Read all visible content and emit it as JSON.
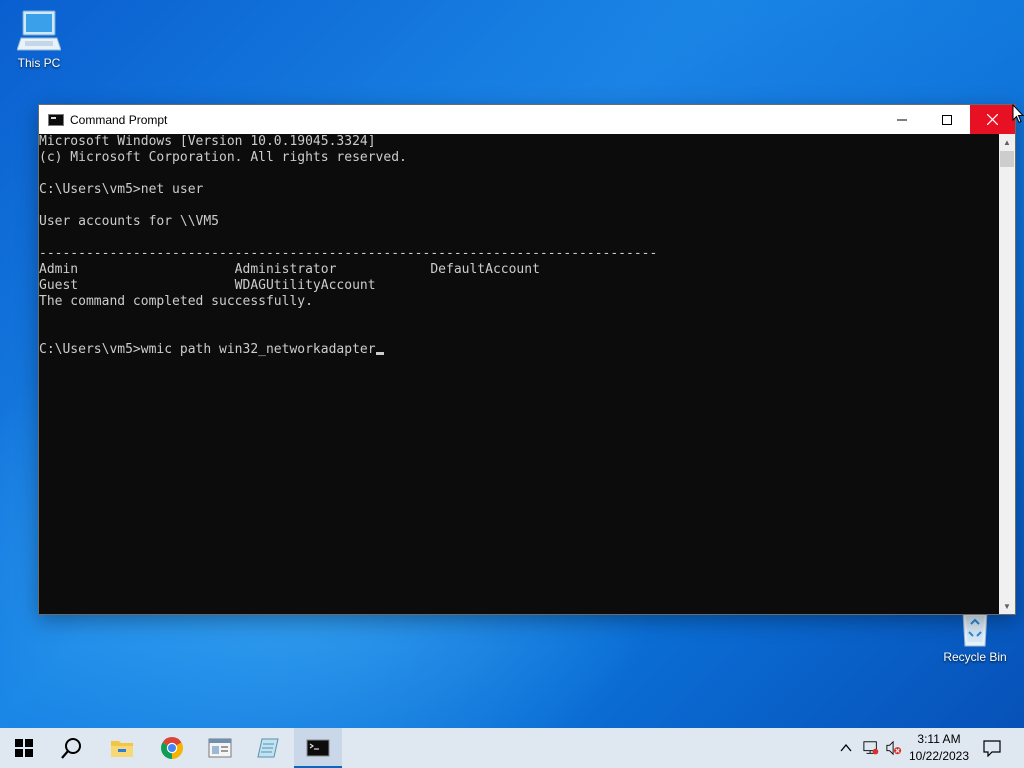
{
  "desktop": {
    "icons": [
      {
        "label": "This PC"
      },
      {
        "label": "Recycle Bin"
      }
    ]
  },
  "window": {
    "title": "Command Prompt",
    "buttons": {
      "minimize": "minimize-icon",
      "maximize": "maximize-icon",
      "close": "close-icon"
    }
  },
  "console": {
    "lines": [
      "Microsoft Windows [Version 10.0.19045.3324]",
      "(c) Microsoft Corporation. All rights reserved.",
      "",
      "C:\\Users\\vm5>net user",
      "",
      "User accounts for \\\\VM5",
      "",
      "-------------------------------------------------------------------------------",
      "Admin                    Administrator            DefaultAccount",
      "Guest                    WDAGUtilityAccount",
      "The command completed successfully.",
      "",
      "",
      "C:\\Users\\vm5>wmic path win32_networkadapter"
    ],
    "colors": {
      "background": "#0c0c0c",
      "text": "#cccccc"
    }
  },
  "taskbar": {
    "apps": [
      "start-icon",
      "search-icon",
      "file-explorer-icon",
      "chrome-icon",
      "app-window-icon",
      "notepad-icon",
      "command-prompt-icon"
    ],
    "clock": {
      "time": "3:11 AM",
      "date": "10/22/2023"
    },
    "accent": "#0a66c2"
  }
}
